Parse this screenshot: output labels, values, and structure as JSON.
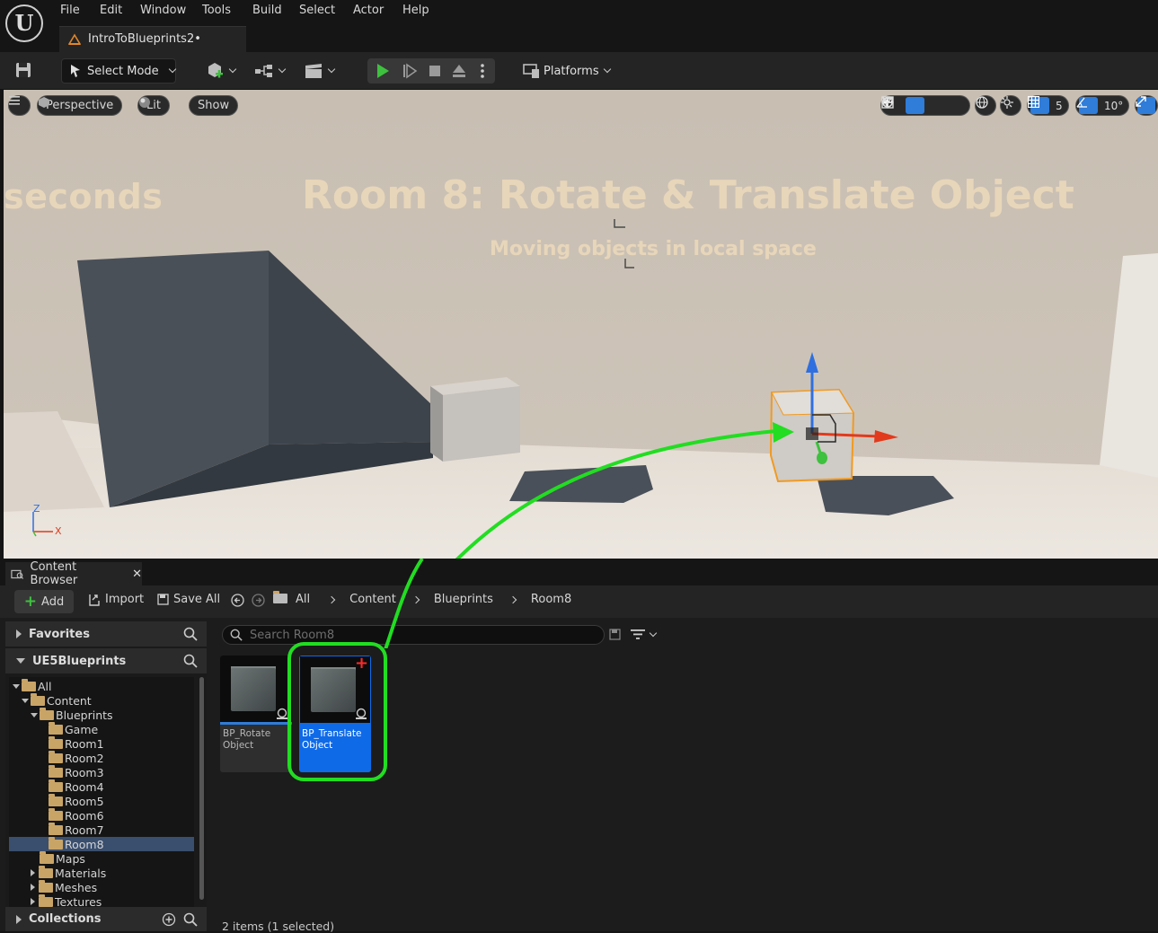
{
  "menu": {
    "items": [
      "File",
      "Edit",
      "Window",
      "Tools",
      "Build",
      "Select",
      "Actor",
      "Help"
    ],
    "document_tab": "IntroToBlueprints2•"
  },
  "toolbar": {
    "select_mode": "Select Mode",
    "platforms": "Platforms"
  },
  "viewport": {
    "perspective": "Perspective",
    "lit": "Lit",
    "show": "Show",
    "grid_size": "5",
    "rotation_snap": "10°",
    "scene_title": "Room 8: Rotate & Translate Object",
    "scene_subtitle": "Moving objects in local space",
    "scene_left_text": "seconds",
    "axis_z": "Z",
    "axis_x": "X",
    "accent_color": "#2f7cd9",
    "highlight_arrow_color": "#22dd22"
  },
  "content_browser": {
    "tab_label": "Content Browser",
    "add_label": "Add",
    "import_label": "Import",
    "save_all_label": "Save All",
    "breadcrumb": [
      "All",
      "Content",
      "Blueprints",
      "Room8"
    ],
    "favorites_label": "Favorites",
    "project_label": "UE5Blueprints",
    "collections_label": "Collections",
    "search_placeholder": "Search Room8",
    "tree": [
      {
        "label": "All",
        "indent": 0
      },
      {
        "label": "Content",
        "indent": 1
      },
      {
        "label": "Blueprints",
        "indent": 2
      },
      {
        "label": "Game",
        "indent": 3
      },
      {
        "label": "Room1",
        "indent": 3
      },
      {
        "label": "Room2",
        "indent": 3
      },
      {
        "label": "Room3",
        "indent": 3
      },
      {
        "label": "Room4",
        "indent": 3
      },
      {
        "label": "Room5",
        "indent": 3
      },
      {
        "label": "Room6",
        "indent": 3
      },
      {
        "label": "Room7",
        "indent": 3
      },
      {
        "label": "Room8",
        "indent": 3,
        "selected": true
      },
      {
        "label": "Maps",
        "indent": 2
      },
      {
        "label": "Materials",
        "indent": 2
      },
      {
        "label": "Meshes",
        "indent": 2
      },
      {
        "label": "Textures",
        "indent": 2
      }
    ],
    "assets": [
      {
        "line1": "BP_Rotate",
        "line2": "Object",
        "selected": false
      },
      {
        "line1": "BP_Translate",
        "line2": "Object",
        "selected": true
      }
    ],
    "status": "2 items (1 selected)"
  }
}
